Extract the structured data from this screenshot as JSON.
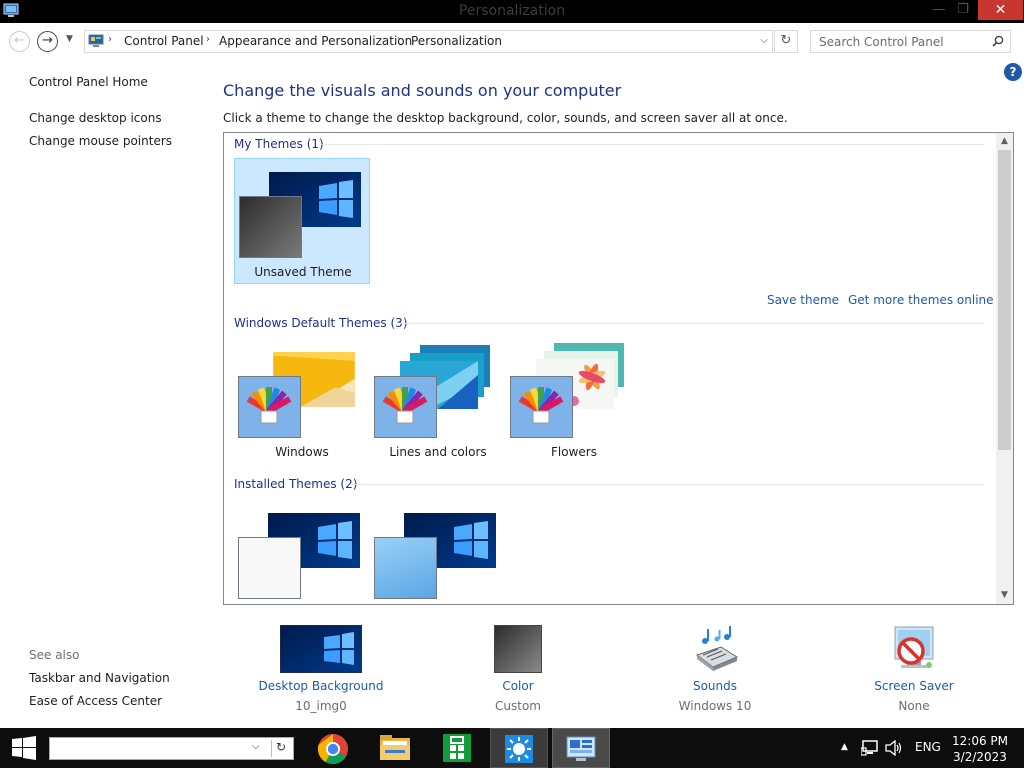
{
  "window": {
    "title": "Personalization",
    "min_glyph": "—",
    "max_glyph": "❐",
    "close_glyph": "✕"
  },
  "nav": {
    "back_glyph": "←",
    "forward_glyph": "→",
    "recent_glyph": "▼",
    "breadcrumb": [
      "Control Panel",
      "Appearance and Personalization",
      "Personalization"
    ],
    "crumb_sep": "›",
    "dropdown_glyph": "⌵",
    "refresh_glyph": "↻",
    "search_placeholder": "Search Control Panel"
  },
  "sidebar": {
    "home": "Control Panel Home",
    "links": [
      "Change desktop icons",
      "Change mouse pointers"
    ],
    "see_also_title": "See also",
    "see_also": [
      "Taskbar and Navigation",
      "Ease of Access Center"
    ]
  },
  "main": {
    "help": "?",
    "heading": "Change the visuals and sounds on your computer",
    "subheading": "Click a theme to change the desktop background, color, sounds, and screen saver all at once.",
    "groups": [
      {
        "title": "My Themes (1)",
        "themes": [
          "Unsaved Theme"
        ]
      },
      {
        "title": "Windows Default Themes (3)",
        "themes": [
          "Windows",
          "Lines and colors",
          "Flowers"
        ]
      },
      {
        "title": "Installed Themes (2)",
        "themes": [
          "",
          ""
        ]
      }
    ],
    "links": {
      "save": "Save theme",
      "more": "Get more themes online"
    },
    "scroll_up": "▲",
    "scroll_down": "▼"
  },
  "quick_settings": [
    {
      "label": "Desktop Background",
      "value": "10_img0",
      "icon": "desktop-background-thumbnail"
    },
    {
      "label": "Color",
      "value": "Custom",
      "icon": "color-swatch"
    },
    {
      "label": "Sounds",
      "value": "Windows 10",
      "icon": "sounds-icon"
    },
    {
      "label": "Screen Saver",
      "value": "None",
      "icon": "screen-saver-icon"
    }
  ],
  "taskbar": {
    "search_dropdown": "⌵",
    "search_refresh": "↻",
    "apps": [
      "chrome-icon",
      "file-explorer-icon",
      "store-icon",
      "display-settings-icon",
      "control-panel-icon"
    ],
    "tray": {
      "up": "▲",
      "lang": "ENG"
    },
    "time": "12:06 PM",
    "date": "3/2/2023"
  },
  "colors": {
    "accent": "#1e5aa8",
    "heading": "#1e3287",
    "selection": "#cce8ff",
    "close": "#c7372f"
  }
}
